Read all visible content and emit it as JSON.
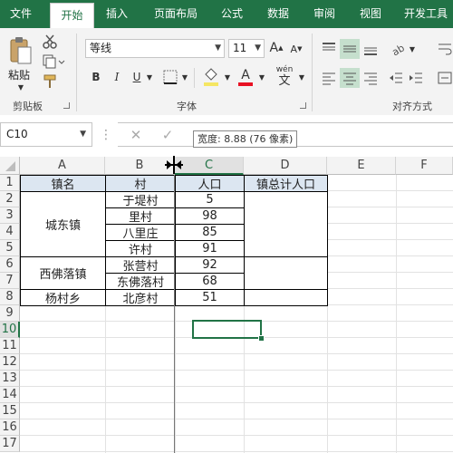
{
  "tabs": [
    "文件",
    "开始",
    "插入",
    "页面布局",
    "公式",
    "数据",
    "审阅",
    "视图",
    "开发工具"
  ],
  "ribbon": {
    "clipboard": {
      "paste": "粘贴",
      "label": "剪贴板"
    },
    "font": {
      "name": "等线",
      "size": "11",
      "label": "字体",
      "grow": "A",
      "shrink": "A",
      "bold": "B",
      "italic": "I",
      "underline": "U",
      "font_color_glyph": "A",
      "phonetic": "wén"
    },
    "alignment": {
      "label": "对齐方式"
    }
  },
  "formula_bar": {
    "name_box": "C10",
    "tooltip": "宽度: 8.88 (76 像素)"
  },
  "sheet": {
    "columns": [
      "A",
      "B",
      "C",
      "D",
      "E",
      "F"
    ],
    "rows": [
      "1",
      "2",
      "3",
      "4",
      "5",
      "6",
      "7",
      "8",
      "9",
      "10",
      "11",
      "12",
      "13",
      "14",
      "15",
      "16",
      "17"
    ],
    "headers": [
      "镇名",
      "村",
      "人口",
      "镇总计人口"
    ],
    "towns": [
      "城东镇",
      "西佛落镇",
      "杨村乡"
    ],
    "villages": [
      "于堤村",
      "里村",
      "八里庄",
      "许村",
      "张营村",
      "东佛落村",
      "北彦村"
    ],
    "population": [
      "5",
      "98",
      "85",
      "91",
      "92",
      "68",
      "51"
    ]
  },
  "colors": {
    "accent": "#217346",
    "header_fill": "#dce6f1"
  }
}
